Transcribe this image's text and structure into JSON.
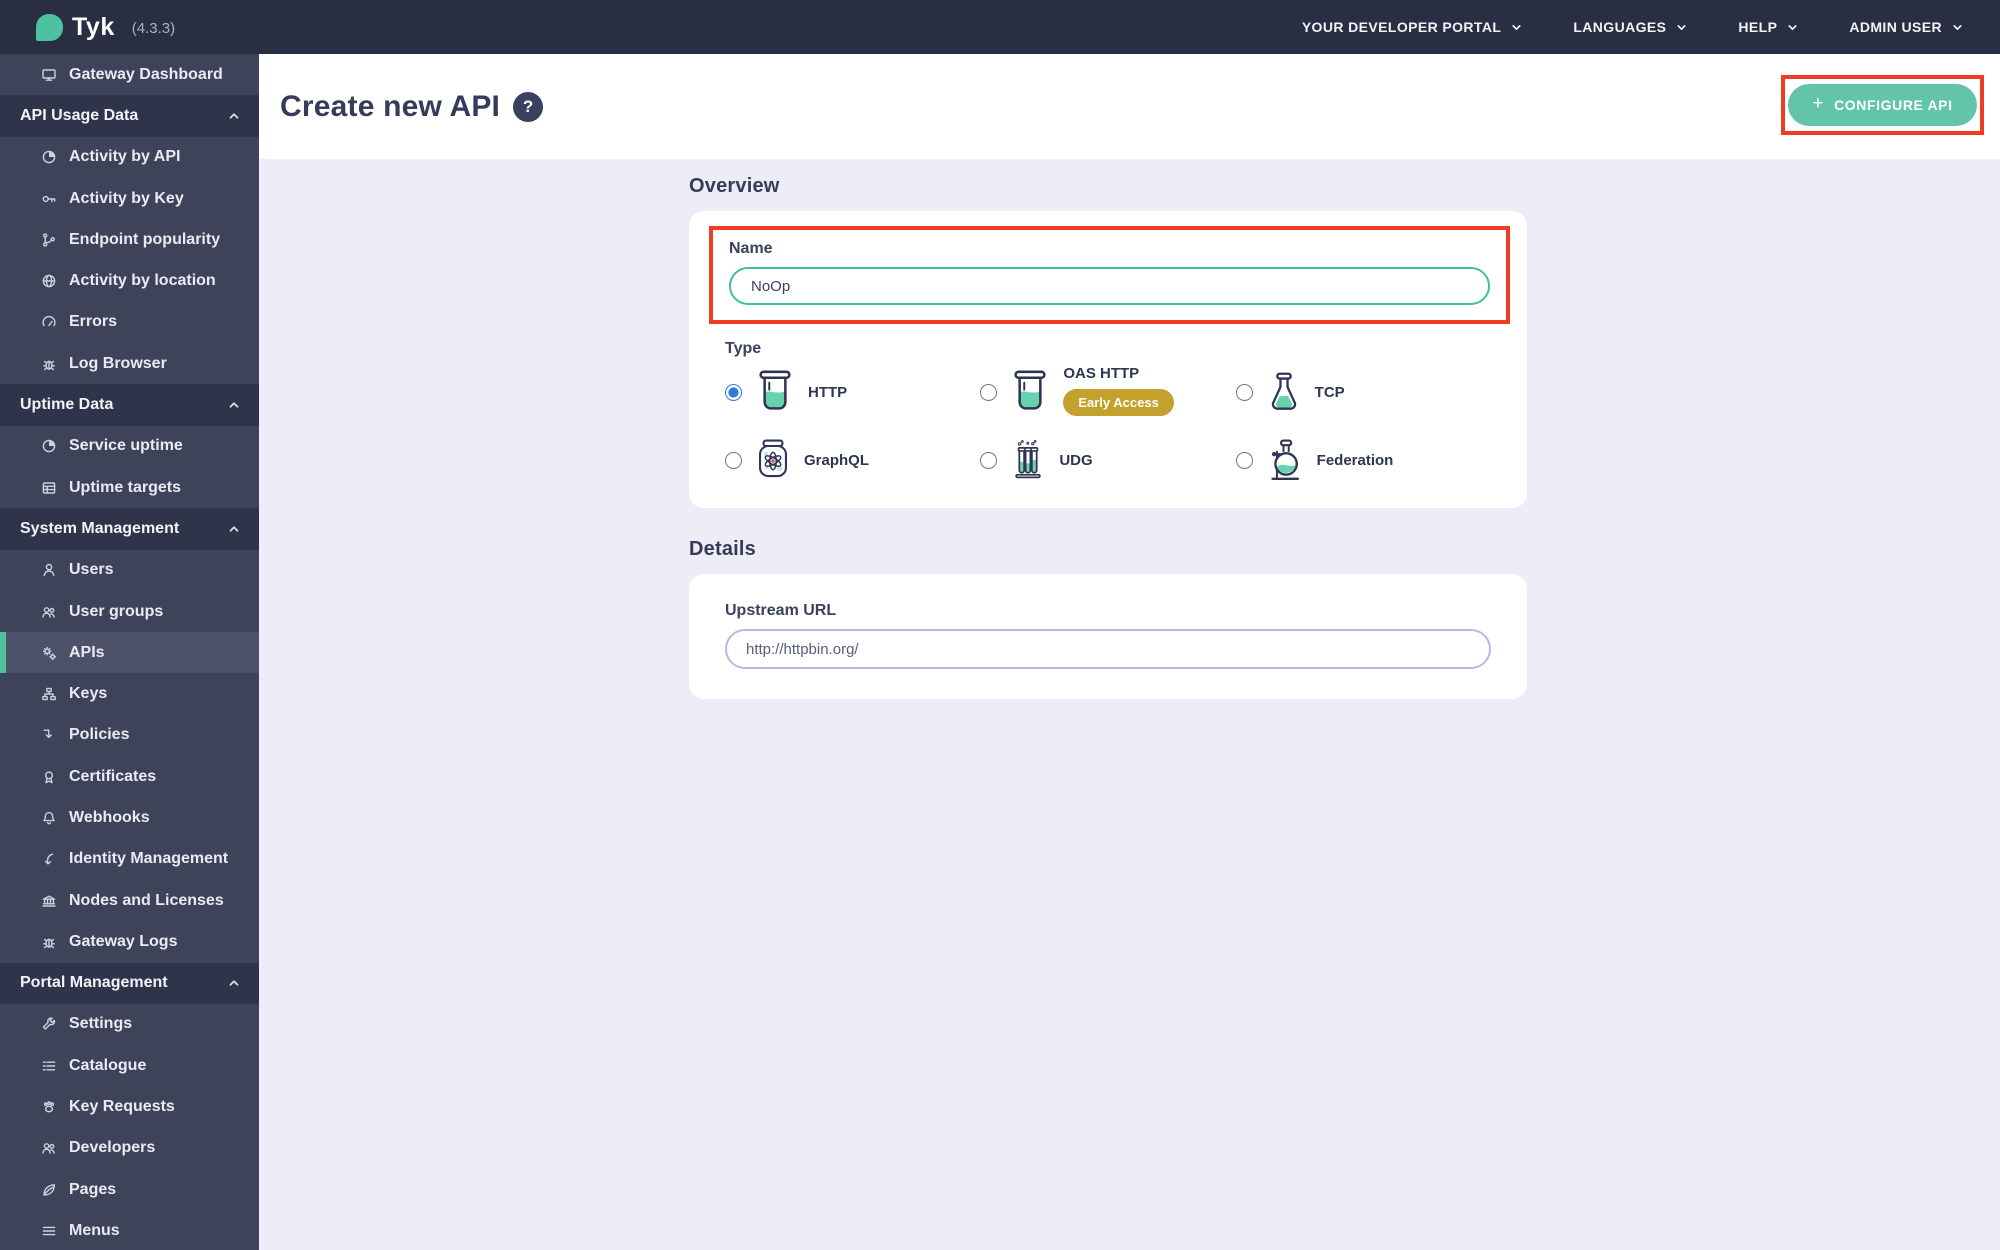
{
  "topbar": {
    "brand": "Tyk",
    "version": "(4.3.3)",
    "menus": [
      {
        "label": "YOUR DEVELOPER PORTAL"
      },
      {
        "label": "LANGUAGES"
      },
      {
        "label": "HELP"
      },
      {
        "label": "ADMIN USER"
      }
    ]
  },
  "sidebar": {
    "items": [
      {
        "kind": "item",
        "label": "Gateway Dashboard",
        "icon": "monitor"
      },
      {
        "kind": "section",
        "label": "API Usage Data"
      },
      {
        "kind": "item",
        "label": "Activity by API",
        "icon": "pie-chart"
      },
      {
        "kind": "item",
        "label": "Activity by Key",
        "icon": "key"
      },
      {
        "kind": "item",
        "label": "Endpoint popularity",
        "icon": "code-branch"
      },
      {
        "kind": "item",
        "label": "Activity by location",
        "icon": "globe"
      },
      {
        "kind": "item",
        "label": "Errors",
        "icon": "gauge"
      },
      {
        "kind": "item",
        "label": "Log Browser",
        "icon": "bug"
      },
      {
        "kind": "section",
        "label": "Uptime Data"
      },
      {
        "kind": "item",
        "label": "Service uptime",
        "icon": "pie-chart"
      },
      {
        "kind": "item",
        "label": "Uptime targets",
        "icon": "table"
      },
      {
        "kind": "section",
        "label": "System Management"
      },
      {
        "kind": "item",
        "label": "Users",
        "icon": "user"
      },
      {
        "kind": "item",
        "label": "User groups",
        "icon": "users"
      },
      {
        "kind": "item",
        "label": "APIs",
        "icon": "gears",
        "selected": true
      },
      {
        "kind": "item",
        "label": "Keys",
        "icon": "sitemap"
      },
      {
        "kind": "item",
        "label": "Policies",
        "icon": "level-down"
      },
      {
        "kind": "item",
        "label": "Certificates",
        "icon": "certificate"
      },
      {
        "kind": "item",
        "label": "Webhooks",
        "icon": "bell"
      },
      {
        "kind": "item",
        "label": "Identity Management",
        "icon": "sign-in"
      },
      {
        "kind": "item",
        "label": "Nodes and Licenses",
        "icon": "bank"
      },
      {
        "kind": "item",
        "label": "Gateway Logs",
        "icon": "bug"
      },
      {
        "kind": "section",
        "label": "Portal Management"
      },
      {
        "kind": "item",
        "label": "Settings",
        "icon": "wrench"
      },
      {
        "kind": "item",
        "label": "Catalogue",
        "icon": "list"
      },
      {
        "kind": "item",
        "label": "Key Requests",
        "icon": "paw"
      },
      {
        "kind": "item",
        "label": "Developers",
        "icon": "users"
      },
      {
        "kind": "item",
        "label": "Pages",
        "icon": "leaf"
      },
      {
        "kind": "item",
        "label": "Menus",
        "icon": "bars"
      }
    ]
  },
  "header": {
    "title": "Create new API",
    "help_text": "?",
    "configure_button": {
      "plus": "+",
      "label": "CONFIGURE API"
    }
  },
  "overview": {
    "heading": "Overview",
    "name_label": "Name",
    "name_value": "NoOp",
    "type_label": "Type",
    "options": [
      {
        "label": "HTTP",
        "icon": "beaker",
        "selected": true
      },
      {
        "label": "OAS HTTP",
        "icon": "beaker",
        "badge": "Early Access"
      },
      {
        "label": "TCP",
        "icon": "erlenmeyer-flask"
      },
      {
        "label": "GraphQL",
        "icon": "jar-atom"
      },
      {
        "label": "UDG",
        "icon": "test-tubes"
      },
      {
        "label": "Federation",
        "icon": "round-flask"
      }
    ]
  },
  "details": {
    "heading": "Details",
    "upstream_label": "Upstream URL",
    "upstream_placeholder": "http://httpbin.org/"
  },
  "colors": {
    "accent_teal": "#63c5a8",
    "input_focus_teal": "#3fc09c",
    "annotation_red": "#ee3d22",
    "badge_gold": "#c3a12d",
    "topbar_bg": "#2a2e43",
    "sidebar_bg": "#3f4359",
    "sidebar_section_bg": "#30344b",
    "sidebar_selected_bg": "#4d5169",
    "selected_accent": "#4ec1a0",
    "content_bg": "#edecf7",
    "radio_selected_blue": "#2e7ce0"
  }
}
